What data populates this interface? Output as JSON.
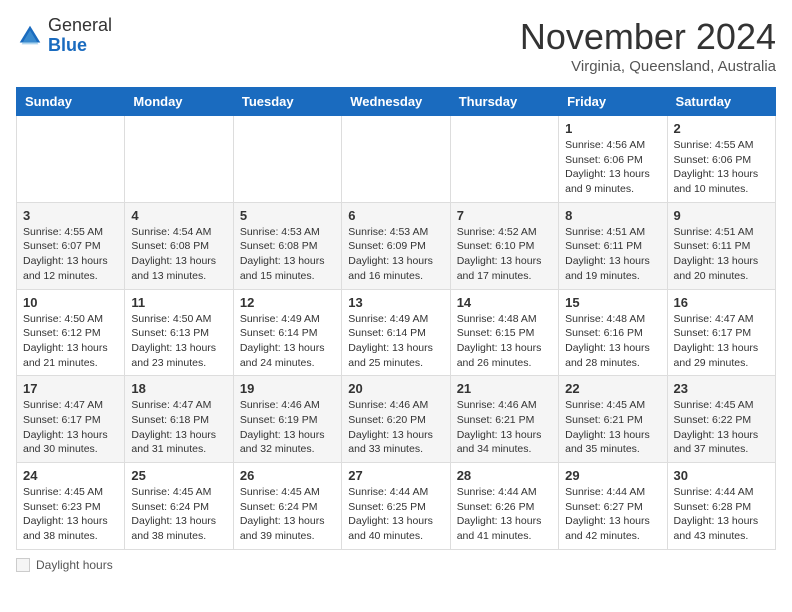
{
  "header": {
    "logo": {
      "general": "General",
      "blue": "Blue"
    },
    "title": "November 2024",
    "subtitle": "Virginia, Queensland, Australia"
  },
  "calendar": {
    "days_of_week": [
      "Sunday",
      "Monday",
      "Tuesday",
      "Wednesday",
      "Thursday",
      "Friday",
      "Saturday"
    ],
    "weeks": [
      [
        {
          "day": "",
          "info": ""
        },
        {
          "day": "",
          "info": ""
        },
        {
          "day": "",
          "info": ""
        },
        {
          "day": "",
          "info": ""
        },
        {
          "day": "",
          "info": ""
        },
        {
          "day": "1",
          "info": "Sunrise: 4:56 AM\nSunset: 6:06 PM\nDaylight: 13 hours and 9 minutes."
        },
        {
          "day": "2",
          "info": "Sunrise: 4:55 AM\nSunset: 6:06 PM\nDaylight: 13 hours and 10 minutes."
        }
      ],
      [
        {
          "day": "3",
          "info": "Sunrise: 4:55 AM\nSunset: 6:07 PM\nDaylight: 13 hours and 12 minutes."
        },
        {
          "day": "4",
          "info": "Sunrise: 4:54 AM\nSunset: 6:08 PM\nDaylight: 13 hours and 13 minutes."
        },
        {
          "day": "5",
          "info": "Sunrise: 4:53 AM\nSunset: 6:08 PM\nDaylight: 13 hours and 15 minutes."
        },
        {
          "day": "6",
          "info": "Sunrise: 4:53 AM\nSunset: 6:09 PM\nDaylight: 13 hours and 16 minutes."
        },
        {
          "day": "7",
          "info": "Sunrise: 4:52 AM\nSunset: 6:10 PM\nDaylight: 13 hours and 17 minutes."
        },
        {
          "day": "8",
          "info": "Sunrise: 4:51 AM\nSunset: 6:11 PM\nDaylight: 13 hours and 19 minutes."
        },
        {
          "day": "9",
          "info": "Sunrise: 4:51 AM\nSunset: 6:11 PM\nDaylight: 13 hours and 20 minutes."
        }
      ],
      [
        {
          "day": "10",
          "info": "Sunrise: 4:50 AM\nSunset: 6:12 PM\nDaylight: 13 hours and 21 minutes."
        },
        {
          "day": "11",
          "info": "Sunrise: 4:50 AM\nSunset: 6:13 PM\nDaylight: 13 hours and 23 minutes."
        },
        {
          "day": "12",
          "info": "Sunrise: 4:49 AM\nSunset: 6:14 PM\nDaylight: 13 hours and 24 minutes."
        },
        {
          "day": "13",
          "info": "Sunrise: 4:49 AM\nSunset: 6:14 PM\nDaylight: 13 hours and 25 minutes."
        },
        {
          "day": "14",
          "info": "Sunrise: 4:48 AM\nSunset: 6:15 PM\nDaylight: 13 hours and 26 minutes."
        },
        {
          "day": "15",
          "info": "Sunrise: 4:48 AM\nSunset: 6:16 PM\nDaylight: 13 hours and 28 minutes."
        },
        {
          "day": "16",
          "info": "Sunrise: 4:47 AM\nSunset: 6:17 PM\nDaylight: 13 hours and 29 minutes."
        }
      ],
      [
        {
          "day": "17",
          "info": "Sunrise: 4:47 AM\nSunset: 6:17 PM\nDaylight: 13 hours and 30 minutes."
        },
        {
          "day": "18",
          "info": "Sunrise: 4:47 AM\nSunset: 6:18 PM\nDaylight: 13 hours and 31 minutes."
        },
        {
          "day": "19",
          "info": "Sunrise: 4:46 AM\nSunset: 6:19 PM\nDaylight: 13 hours and 32 minutes."
        },
        {
          "day": "20",
          "info": "Sunrise: 4:46 AM\nSunset: 6:20 PM\nDaylight: 13 hours and 33 minutes."
        },
        {
          "day": "21",
          "info": "Sunrise: 4:46 AM\nSunset: 6:21 PM\nDaylight: 13 hours and 34 minutes."
        },
        {
          "day": "22",
          "info": "Sunrise: 4:45 AM\nSunset: 6:21 PM\nDaylight: 13 hours and 35 minutes."
        },
        {
          "day": "23",
          "info": "Sunrise: 4:45 AM\nSunset: 6:22 PM\nDaylight: 13 hours and 37 minutes."
        }
      ],
      [
        {
          "day": "24",
          "info": "Sunrise: 4:45 AM\nSunset: 6:23 PM\nDaylight: 13 hours and 38 minutes."
        },
        {
          "day": "25",
          "info": "Sunrise: 4:45 AM\nSunset: 6:24 PM\nDaylight: 13 hours and 38 minutes."
        },
        {
          "day": "26",
          "info": "Sunrise: 4:45 AM\nSunset: 6:24 PM\nDaylight: 13 hours and 39 minutes."
        },
        {
          "day": "27",
          "info": "Sunrise: 4:44 AM\nSunset: 6:25 PM\nDaylight: 13 hours and 40 minutes."
        },
        {
          "day": "28",
          "info": "Sunrise: 4:44 AM\nSunset: 6:26 PM\nDaylight: 13 hours and 41 minutes."
        },
        {
          "day": "29",
          "info": "Sunrise: 4:44 AM\nSunset: 6:27 PM\nDaylight: 13 hours and 42 minutes."
        },
        {
          "day": "30",
          "info": "Sunrise: 4:44 AM\nSunset: 6:28 PM\nDaylight: 13 hours and 43 minutes."
        }
      ]
    ]
  },
  "legend": {
    "label": "Daylight hours"
  }
}
